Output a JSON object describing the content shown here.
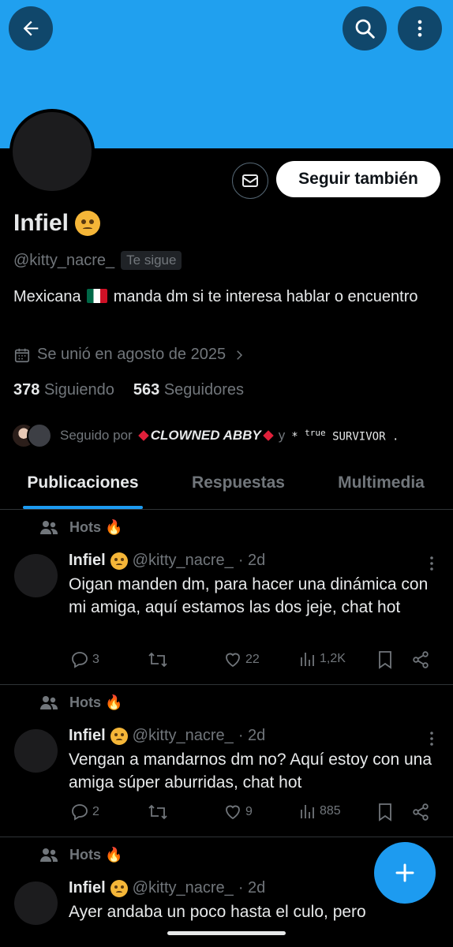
{
  "header": {
    "back_icon": "arrow-left-icon",
    "search_icon": "search-icon",
    "more_icon": "more-vertical-icon",
    "banner_color": "#20a0ef"
  },
  "profile": {
    "name": "Infiel",
    "handle": "@kitty_nacre_",
    "follows_you": "Te sigue",
    "follow_button": "Seguir también",
    "bio_before_flag": "Mexicana",
    "bio_after_flag": "manda dm si te interesa hablar o encuentro",
    "joined": "Se unió en agosto de 2025",
    "following_count": "378",
    "following_label": "Siguiendo",
    "followers_count": "563",
    "followers_label": "Seguidores",
    "followed_by_prefix": "Seguido por",
    "followed_by_name1": "CLOWNED ABBY",
    "followed_by_and": "y",
    "followed_by_name2_sup": "true",
    "followed_by_name2": "SURVIVOR",
    "followed_by_suffix": "."
  },
  "tabs": [
    {
      "label": "Publicaciones",
      "active": true
    },
    {
      "label": "Respuestas",
      "active": false
    },
    {
      "label": "Multimedia",
      "active": false
    }
  ],
  "posts": [
    {
      "context": "Hots 🔥",
      "name": "Infiel",
      "handle": "@kitty_nacre_",
      "time": "· 2d",
      "text": "Oigan manden dm, para hacer una dinámica con mi amiga, aquí estamos las dos jeje, chat hot",
      "replies": "3",
      "reposts": "",
      "likes": "22",
      "views": "1,2K"
    },
    {
      "context": "Hots 🔥",
      "name": "Infiel",
      "handle": "@kitty_nacre_",
      "time": "· 2d",
      "text": "Vengan a mandarnos dm no? Aquí estoy con una amiga súper aburridas, chat hot",
      "replies": "2",
      "reposts": "",
      "likes": "9",
      "views": "885"
    },
    {
      "context": "Hots 🔥",
      "name": "Infiel",
      "handle": "@kitty_nacre_",
      "time": "· 2d",
      "text": "Ayer andaba un poco hasta el culo, pero"
    }
  ],
  "fab_icon": "plus-icon"
}
